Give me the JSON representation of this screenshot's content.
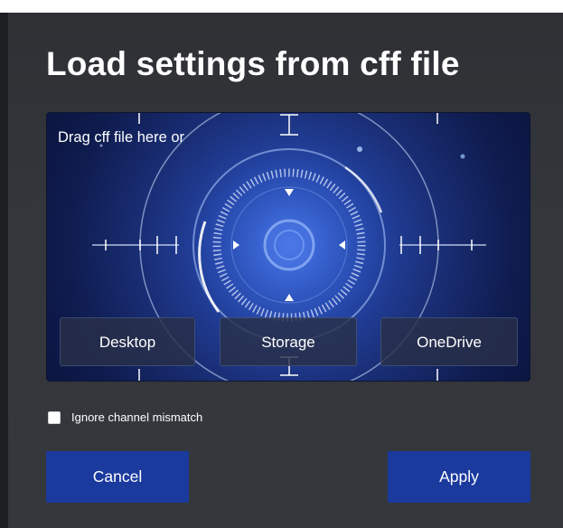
{
  "dialog": {
    "title": "Load settings from cff file"
  },
  "drop_zone": {
    "hint": "Drag cff file here or",
    "sources": [
      {
        "label": "Desktop"
      },
      {
        "label": "Storage"
      },
      {
        "label": "OneDrive"
      }
    ]
  },
  "options": {
    "ignore_channel_mismatch_label": "Ignore channel mismatch",
    "ignore_channel_mismatch_checked": false
  },
  "actions": {
    "cancel_label": "Cancel",
    "apply_label": "Apply"
  },
  "colors": {
    "dialog_bg": "#33363b",
    "button_bg": "#1b3a9e",
    "drop_zone_glow": "#2f5fd0"
  }
}
